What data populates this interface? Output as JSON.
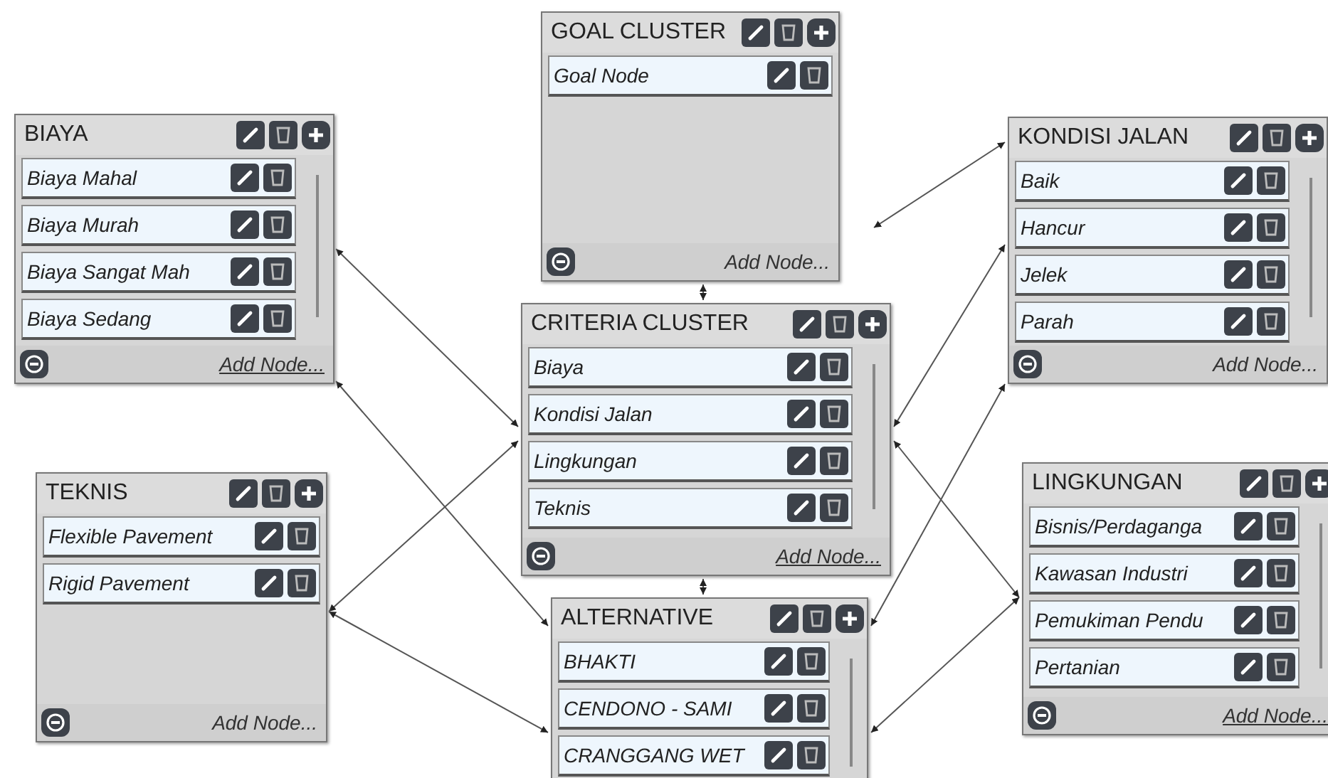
{
  "clusters": [
    {
      "title": "GOAL CLUSTER",
      "nodes": [
        {
          "label": "Goal Node"
        }
      ],
      "add_node": "Add Node...",
      "add_node_underlined": false
    },
    {
      "title": "BIAYA",
      "nodes": [
        {
          "label": "Biaya Mahal"
        },
        {
          "label": "Biaya Murah"
        },
        {
          "label": "Biaya Sangat Mah"
        },
        {
          "label": "Biaya Sedang"
        }
      ],
      "add_node": "Add Node...",
      "add_node_underlined": true
    },
    {
      "title": "KONDISI JALAN",
      "nodes": [
        {
          "label": "Baik"
        },
        {
          "label": "Hancur"
        },
        {
          "label": "Jelek"
        },
        {
          "label": "Parah"
        }
      ],
      "add_node": "Add Node...",
      "add_node_underlined": false
    },
    {
      "title": "CRITERIA CLUSTER",
      "nodes": [
        {
          "label": "Biaya"
        },
        {
          "label": "Kondisi Jalan"
        },
        {
          "label": "Lingkungan"
        },
        {
          "label": "Teknis"
        }
      ],
      "add_node": "Add Node...",
      "add_node_underlined": true
    },
    {
      "title": "TEKNIS",
      "nodes": [
        {
          "label": "Flexible Pavement"
        },
        {
          "label": "Rigid Pavement"
        }
      ],
      "add_node": "Add Node...",
      "add_node_underlined": false
    },
    {
      "title": "LINGKUNGAN",
      "nodes": [
        {
          "label": "Bisnis/Perdaganga"
        },
        {
          "label": "Kawasan Industri"
        },
        {
          "label": "Pemukiman Pendu"
        },
        {
          "label": "Pertanian"
        }
      ],
      "add_node": "Add Node...",
      "add_node_underlined": true
    },
    {
      "title": "ALTERNATIVE",
      "nodes": [
        {
          "label": "BHAKTI"
        },
        {
          "label": "CENDONO - SAMI"
        },
        {
          "label": "CRANGGANG WET"
        }
      ]
    }
  ]
}
